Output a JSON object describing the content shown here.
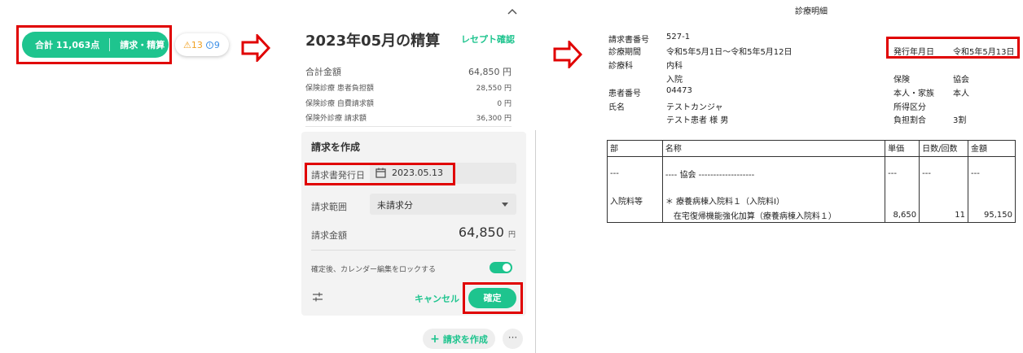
{
  "summary_bar": {
    "total_label": "合計 11,063点",
    "action_label": "請求・精算",
    "warning_count": "13",
    "info_count": "9"
  },
  "settlement": {
    "title": "2023年05月の精算",
    "receipt_check": "レセプト確認",
    "rows": [
      {
        "label": "合計金額",
        "value": "64,850 円"
      },
      {
        "label": "保険診療 患者負担額",
        "value": "28,550 円"
      },
      {
        "label": "保険診療 自費請求額",
        "value": "0 円"
      },
      {
        "label": "保険外診療 請求額",
        "value": "36,300 円"
      }
    ],
    "form": {
      "heading": "請求を作成",
      "issue_date_label": "請求書発行日",
      "issue_date_value": "2023.05.13",
      "range_label": "請求範囲",
      "range_value": "未請求分",
      "amount_label": "請求金額",
      "amount_value": "64,850",
      "amount_unit": "円",
      "lock_label": "確定後、カレンダー編集をロックする",
      "cancel_label": "キャンセル",
      "confirm_label": "確定"
    },
    "create_button": "請求を作成",
    "more_button": "···"
  },
  "statement": {
    "title": "診療明細",
    "fields": [
      {
        "label": "請求書番号",
        "value": "527-1"
      },
      {
        "label": "診療期間",
        "value": "令和5年5月1日～令和5年5月12日"
      },
      {
        "label": "診療科",
        "value": "内科"
      },
      {
        "label": "",
        "value": "入院"
      },
      {
        "label": "患者番号",
        "value": "04473"
      },
      {
        "label": "氏名",
        "value": "テストカンジャ"
      },
      {
        "label": "",
        "value": "テスト患者 様 男"
      }
    ],
    "issue_date_label": "発行年月日",
    "issue_date_value": "令和5年5月13日",
    "right_fields": [
      {
        "label": "保険",
        "value": "協会"
      },
      {
        "label": "本人・家族",
        "value": "本人"
      },
      {
        "label": "所得区分",
        "value": ""
      },
      {
        "label": "負担割合",
        "value": "3割"
      }
    ],
    "table": {
      "headers": [
        "部",
        "名称",
        "単価",
        "日数/回数",
        "金額"
      ],
      "dash_row": [
        "---",
        "---- 協会 -------------------",
        "---",
        "---",
        "---"
      ],
      "section": "入院料等",
      "item1": "＊ 療養病棟入院料１（入院料Ⅰ）",
      "item2": "在宅復帰機能強化加算（療養病棟入院料１）",
      "unit_price": "8,650",
      "days": "11",
      "amount": "95,150"
    }
  },
  "colors": {
    "accent": "#1ec48e",
    "highlight": "#e00000",
    "warning": "#f0a020",
    "info": "#3a8ee6"
  }
}
